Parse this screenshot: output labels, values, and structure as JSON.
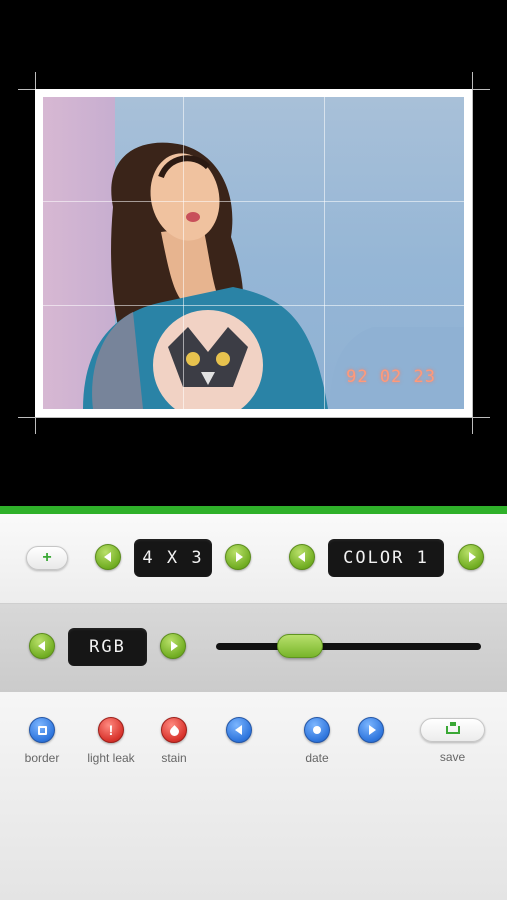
{
  "preview": {
    "date_stamp": "92 02 23"
  },
  "toolbar_top": {
    "add_label": "+",
    "aspect_value": "4 X 3",
    "color_value": "COLOR 1"
  },
  "toolbar_middle": {
    "mode_value": "RGB",
    "slider_fraction": 0.28
  },
  "tools": {
    "border_label": "border",
    "light_leak_label": "light leak",
    "light_leak_glyph": "!",
    "stain_label": "stain",
    "date_label": "date",
    "save_label": "save"
  },
  "colors": {
    "accent_green": "#2fb12a",
    "lcd_background": "#161616",
    "blue_button": "#2f76dd",
    "red_button": "#d8332c"
  }
}
